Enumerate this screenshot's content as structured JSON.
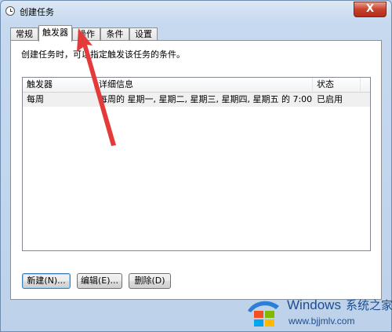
{
  "window": {
    "title": "创建任务",
    "close_label": "X"
  },
  "tabs": [
    {
      "label": "常规"
    },
    {
      "label": "触发器"
    },
    {
      "label": "操作"
    },
    {
      "label": "条件"
    },
    {
      "label": "设置"
    }
  ],
  "active_tab": "触发器",
  "panel": {
    "description": "创建任务时，可以指定触发该任务的条件。",
    "columns": [
      "触发器",
      "详细信息",
      "状态"
    ],
    "rows": [
      {
        "trigger": "每周",
        "details": "每周的 星期一, 星期二, 星期三, 星期四, 星期五 的 7:00 时，开...",
        "status": "已启用"
      }
    ]
  },
  "buttons": {
    "new": "新建(N)...",
    "edit": "编辑(E)...",
    "delete": "删除(D)"
  },
  "watermark": {
    "title": "Windows",
    "title_cn": "系统之家",
    "url": "www.bjjmlv.com"
  },
  "colors": {
    "annotation_arrow": "#e53a3a",
    "close_button": "#c7412b",
    "row_highlight": "#f0f0f0"
  }
}
